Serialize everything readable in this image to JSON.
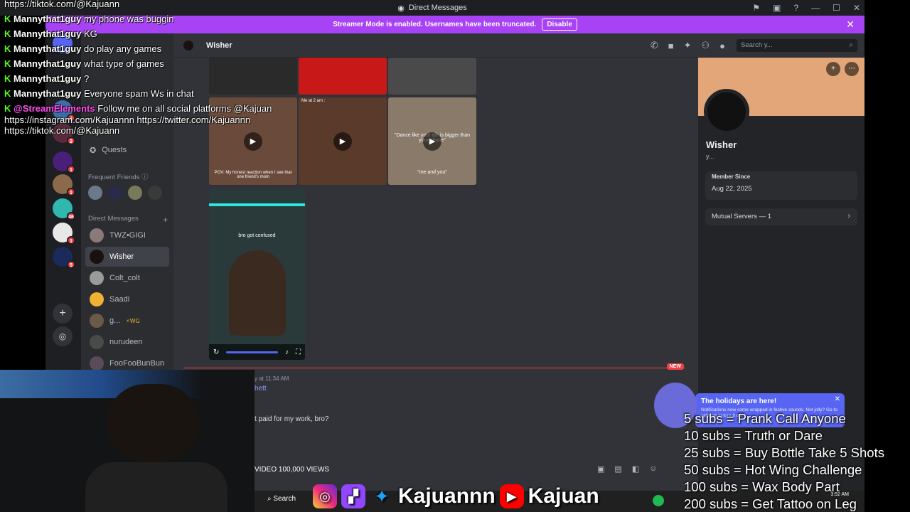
{
  "titlebar": {
    "title": "Direct Messages"
  },
  "banner": {
    "text": "Streamer Mode is enabled. Usernames have been truncated.",
    "button": "Disable"
  },
  "sidebar": {
    "quests_label": "Quests",
    "frequent_friends": "Frequent Friends",
    "direct_messages": "Direct Messages",
    "dms": [
      {
        "name": "TWZ•GIGI"
      },
      {
        "name": "Wisher"
      },
      {
        "name": "Colt_colt"
      },
      {
        "name": "Saadi"
      },
      {
        "name": "g..."
      },
      {
        "name": "nurudeen"
      },
      {
        "name": "FooFooBunBun"
      }
    ],
    "badges": [
      "1",
      "2",
      "1",
      "1",
      "46",
      "1",
      "5"
    ]
  },
  "channel": {
    "name": "Wisher",
    "search_placeholder": "Search y..."
  },
  "chat": {
    "captions": [
      "POV: My honest reaction when I see that one friend's mom",
      "Me at 2 am :",
      "\"Dance like your dih is bigger than your phone\"",
      "\"me and you\"",
      "bro got confused"
    ],
    "new_label": "NEW",
    "timestamp": "y at 11:34 AM",
    "reply_name": "hett",
    "message": "t paid for my work, bro?"
  },
  "profile": {
    "name": "Wisher",
    "status": "y...",
    "member_since_label": "Member Since",
    "member_since": "Aug 22, 2025",
    "mutual_servers": "Mutual Servers — 1"
  },
  "overlay": {
    "chat": [
      {
        "text": "https://tiktok.com/@Kajuann"
      },
      {
        "user": "Mannythat1guy",
        "msg": "my phone was buggin"
      },
      {
        "user": "Mannythat1guy",
        "msg": "KG"
      },
      {
        "user": "Mannythat1guy",
        "msg": "do play any games"
      },
      {
        "user": "Mannythat1guy",
        "msg": "what type of games"
      },
      {
        "user": "Mannythat1guy",
        "msg": "?"
      },
      {
        "user": "Mannythat1guy",
        "msg": "Everyone spam Ws in chat"
      },
      {
        "user": "@StreamElements",
        "msg": "Follow me on all social platforms @Kajuan"
      },
      {
        "text": "https://instagram.com/Kajuannn https://twitter.com/Kajuannn"
      },
      {
        "text": "https://tiktok.com/@Kajuann"
      }
    ],
    "subgoals": [
      "5 subs = Prank Call Anyone",
      "10 subs = Truth or Dare",
      "25 subs = Buy Bottle Take 5 Shots",
      "50 subs = Hot Wing Challenge",
      "100 subs = Wax Body Part",
      "200 subs = Get Tattoo on Leg"
    ],
    "social_name_1": "Kajuannn",
    "social_name_2": "Kajuan",
    "views": "VIDEO 100,000 VIEWS",
    "holiday_title": "The holidays are here!",
    "holiday_body": "Notifications now come wrapped in festive sounds. Not jolly? Go to settings to turn it off.",
    "taskbar_search": "Search",
    "clock": "3:52 AM"
  }
}
